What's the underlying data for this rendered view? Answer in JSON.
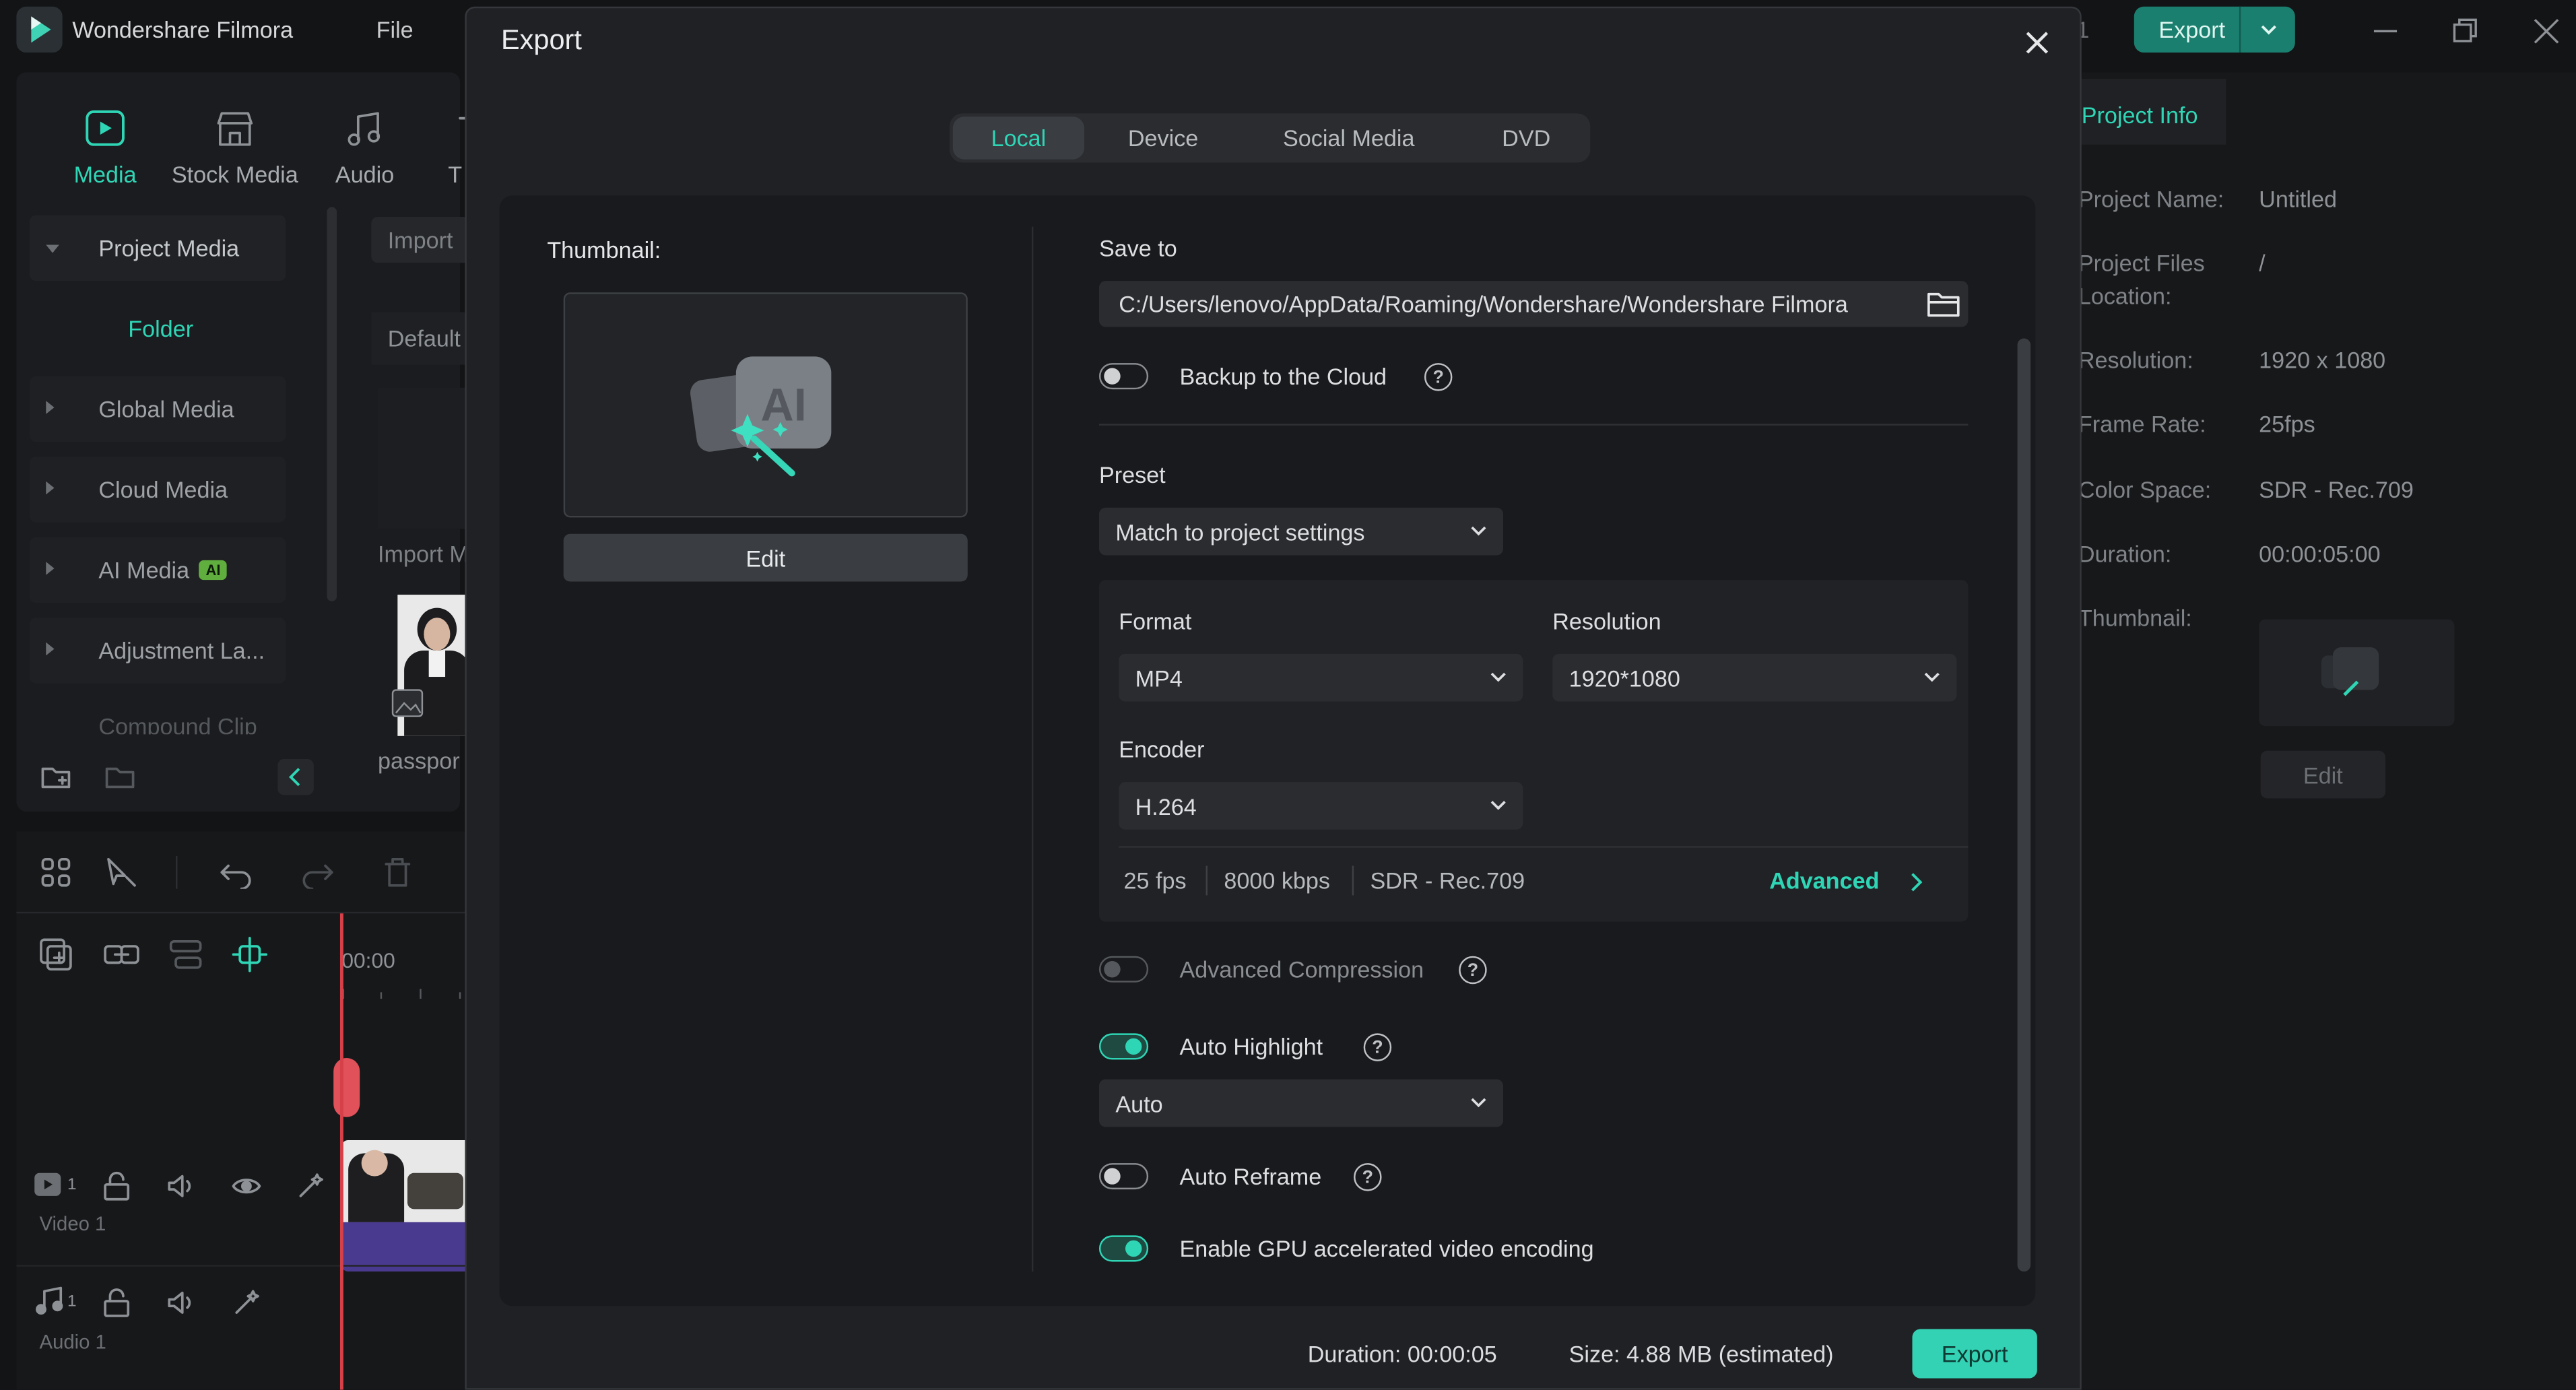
{
  "app": {
    "title": "Wondershare Filmora",
    "menu_file": "File",
    "export_label": "Export",
    "partial_digit": "1"
  },
  "top_tabs": [
    {
      "label": "Media"
    },
    {
      "label": "Stock Media"
    },
    {
      "label": "Audio"
    },
    {
      "label": "T"
    }
  ],
  "library": {
    "items": [
      {
        "label": "Project Media"
      },
      {
        "label": "Folder"
      },
      {
        "label": "Global Media"
      },
      {
        "label": "Cloud Media"
      },
      {
        "label": "AI Media",
        "badge": "AI"
      },
      {
        "label": "Adjustment La..."
      },
      {
        "label": "Compound Clip"
      }
    ],
    "import_label": "Import",
    "default_label": "Default",
    "import_media_label": "Import M",
    "clip_name": "passpor"
  },
  "timeline": {
    "time": "00:00",
    "video_track_label": "Video 1",
    "audio_track_label": "Audio 1",
    "video_track_num": "1",
    "audio_track_num": "1"
  },
  "dialog": {
    "title": "Export",
    "tabs": [
      "Local",
      "Device",
      "Social Media",
      "DVD"
    ],
    "active_tab": "Local",
    "thumbnail_label": "Thumbnail:",
    "edit_label": "Edit",
    "save_to_label": "Save to",
    "save_path": "C:/Users/lenovo/AppData/Roaming/Wondershare/Wondershare Filmora",
    "backup_label": "Backup to the Cloud",
    "preset_label": "Preset",
    "preset_value": "Match to project settings",
    "format_label": "Format",
    "format_value": "MP4",
    "resolution_label": "Resolution",
    "resolution_value": "1920*1080",
    "encoder_label": "Encoder",
    "encoder_value": "H.264",
    "fps": "25 fps",
    "bitrate": "8000 kbps",
    "colorspace": "SDR - Rec.709",
    "advanced_label": "Advanced",
    "adv_compression_label": "Advanced Compression",
    "auto_highlight_label": "Auto Highlight",
    "auto_highlight_value": "Auto",
    "auto_reframe_label": "Auto Reframe",
    "gpu_label": "Enable GPU accelerated video encoding",
    "help_glyph": "?",
    "duration_text": "Duration: 00:00:05",
    "size_text": "Size:  4.88 MB (estimated)",
    "export_label": "Export",
    "toggles": {
      "backup": false,
      "adv_compression": false,
      "auto_highlight": true,
      "auto_reframe": false,
      "gpu": true
    }
  },
  "project_info": {
    "tab_label": "Project Info",
    "rows": [
      {
        "key": "Project Name:",
        "value": "Untitled"
      },
      {
        "key": "Project Files",
        "key2": "Location:",
        "value": "/"
      },
      {
        "key": "Resolution:",
        "value": "1920 x 1080"
      },
      {
        "key": "Frame Rate:",
        "value": "25fps"
      },
      {
        "key": "Color Space:",
        "value": "SDR - Rec.709"
      },
      {
        "key": "Duration:",
        "value": "00:00:05:00"
      },
      {
        "key": "Thumbnail:",
        "value": ""
      }
    ],
    "edit_label": "Edit"
  },
  "colors": {
    "accent": "#2fd6b6",
    "export_button": "#33d2b4",
    "top_export": "#1a7f6e",
    "playhead": "#d64048"
  }
}
